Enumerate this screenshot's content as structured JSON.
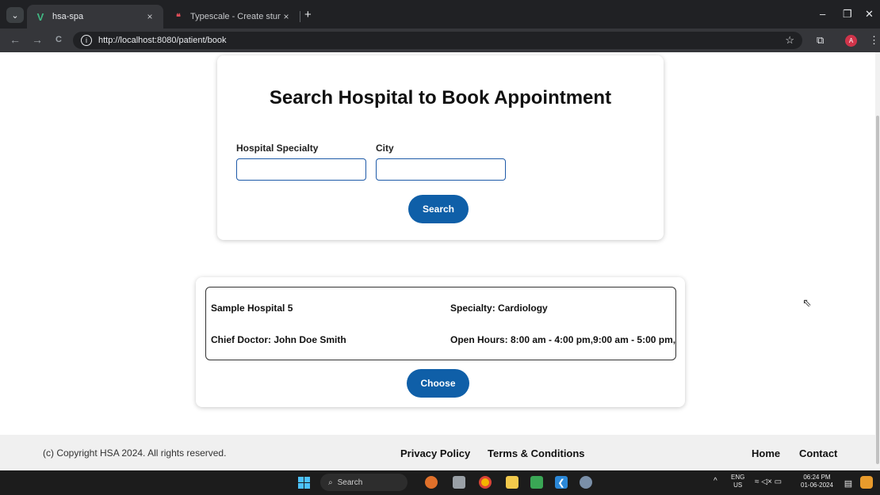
{
  "browser": {
    "tabs": [
      {
        "title": "hsa-spa",
        "close": "×"
      },
      {
        "title": "Typescale - Create stunning typ",
        "close": "×"
      }
    ],
    "new_tab": "+",
    "window_controls": {
      "minimize": "–",
      "restore": "❐",
      "close": "✕"
    },
    "url": "http://localhost:8080/patient/book",
    "profile_initial": "A",
    "icons": {
      "back": "←",
      "forward": "→",
      "reload": "C",
      "info": "ⓘ",
      "star": "☆",
      "extensions": "⧉",
      "menu": "⋮"
    }
  },
  "search_card": {
    "title": "Search Hospital to Book Appointment",
    "specialty_label": "Hospital Specialty",
    "specialty_value": "",
    "city_label": "City",
    "city_value": "",
    "search_button": "Search"
  },
  "result": {
    "hospital_name": "Sample Hospital 5",
    "specialty": "Specialty: Cardiology",
    "chief_doctor": "Chief Doctor: John Doe Smith",
    "open_hours": "Open Hours: 8:00 am - 4:00 pm,9:00 am - 5:00 pm,",
    "choose_button": "Choose"
  },
  "footer": {
    "copyright": "(c) Copyright HSA 2024. All rights reserved.",
    "privacy": "Privacy Policy",
    "terms": "Terms & Conditions",
    "home": "Home",
    "contact": "Contact"
  },
  "taskbar": {
    "search_label": "Search",
    "lang_top": "ENG",
    "lang_bottom": "US",
    "time": "06:24 PM",
    "date": "01-06-2024",
    "tray_chevron": "^"
  },
  "colors": {
    "primary_button": "#0f5fa8",
    "input_border": "#1e5aa8",
    "chrome_dark": "#202124"
  }
}
